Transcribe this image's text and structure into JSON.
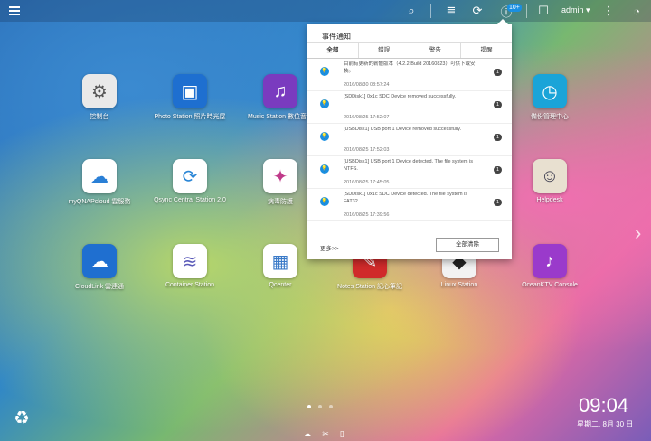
{
  "topbar": {
    "admin_label": "admin ▾",
    "badge": "10+",
    "icons": [
      "menu-icon",
      "search-icon",
      "tasks-icon",
      "sync-icon",
      "info-icon",
      "user-icon",
      "more-icon",
      "dashboard-icon"
    ]
  },
  "apps": [
    {
      "label": "控制台",
      "color": "#e9e9e9",
      "glyph": "⚙",
      "glyphColor": "#555"
    },
    {
      "label": "Photo Station 照片時光屋",
      "color": "#1e6fd0",
      "glyph": "▣",
      "glyphColor": "#fff"
    },
    {
      "label": "Music Station 數位音樂",
      "color": "#7a3bbf",
      "glyph": "♫",
      "glyphColor": "#fff"
    },
    {
      "label": "備份管理中心",
      "color": "#1aa4d8",
      "glyph": "◷",
      "glyphColor": "#fff"
    },
    {
      "label": "myQNAPcloud 雲服務",
      "color": "#ffffff",
      "glyph": "☁",
      "glyphColor": "#2a7fd6"
    },
    {
      "label": "Qsync Central Station 2.0",
      "color": "#ffffff",
      "glyph": "⟳",
      "glyphColor": "#2a86d6"
    },
    {
      "label": "病毒防護",
      "color": "#ffffff",
      "glyph": "✦",
      "glyphColor": "#c03a8a"
    },
    {
      "label": "Helpdesk",
      "color": "#e8e0d0",
      "glyph": "☺",
      "glyphColor": "#445"
    },
    {
      "label": "CloudLink 雲連通",
      "color": "#1f6fd0",
      "glyph": "☁",
      "glyphColor": "#fff"
    },
    {
      "label": "Container Station",
      "color": "#ffffff",
      "glyph": "≋",
      "glyphColor": "#5a5ab8"
    },
    {
      "label": "Qcenter",
      "color": "#ffffff",
      "glyph": "▦",
      "glyphColor": "#3a7ac8"
    },
    {
      "label": "Notes Station 記心筆記",
      "color": "#d02a2a",
      "glyph": "✎",
      "glyphColor": "#fff"
    },
    {
      "label": "Linux Station",
      "color": "#f2f2f2",
      "glyph": "◆",
      "glyphColor": "#222"
    },
    {
      "label": "OceanKTV Console",
      "color": "#9a3acb",
      "glyph": "♪",
      "glyphColor": "#fff"
    }
  ],
  "panel": {
    "title": "事件通知",
    "tabs": [
      "全部",
      "錯誤",
      "警告",
      "提醒"
    ],
    "entries": [
      {
        "msg": "目前有更新的韌體版本（4.2.2 Build 20160823）可供下載安裝。",
        "time": "2016/08/30 08:57:24",
        "count": "1"
      },
      {
        "msg": "[SDDisk1] 0x1c SDC Device removed successfully.",
        "time": "2016/08/25 17:52:07",
        "count": "1"
      },
      {
        "msg": "[USBDisk1] USB port 1 Device removed successfully.",
        "time": "2016/08/25 17:52:03",
        "count": "1"
      },
      {
        "msg": "[USBDisk1] USB port 1 Device detected. The file system is NTFS.",
        "time": "2016/08/25 17:45:05",
        "count": "1"
      },
      {
        "msg": "[SDDisk1] 0x1c SDC Device detected. The file system is FAT32.",
        "time": "2016/08/25 17:39:56",
        "count": "1"
      }
    ],
    "more": "更多>>",
    "clear": "全部清除"
  },
  "clock": "09:04",
  "date": "星期二, 8月 30 日"
}
